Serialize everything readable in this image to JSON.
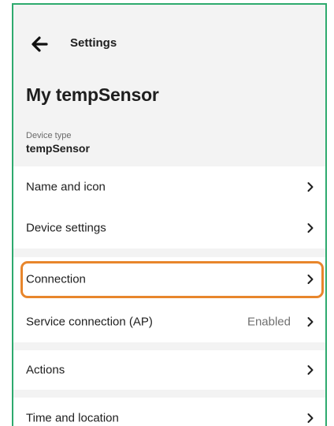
{
  "appbar": {
    "title": "Settings",
    "back_icon": "arrow-left-icon"
  },
  "device": {
    "name": "My tempSensor",
    "type_label": "Device type",
    "type_value": "tempSensor"
  },
  "menu": {
    "name_and_icon": {
      "label": "Name and icon"
    },
    "device_settings": {
      "label": "Device settings"
    },
    "connection": {
      "label": "Connection",
      "highlighted": true
    },
    "service_connection": {
      "label": "Service connection (AP)",
      "value": "Enabled"
    },
    "actions": {
      "label": "Actions"
    },
    "time_and_location": {
      "label": "Time and location"
    }
  },
  "colors": {
    "frame_border": "#2eaa6e",
    "highlight": "#e8862c",
    "page_background": "#f3f3f3"
  }
}
